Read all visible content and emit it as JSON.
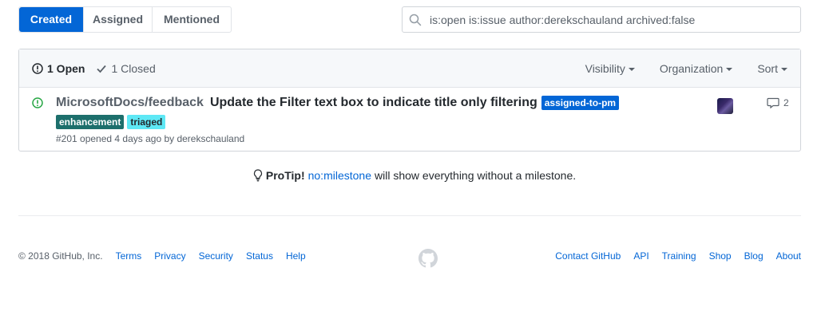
{
  "tabs": [
    {
      "label": "Created",
      "active": true
    },
    {
      "label": "Assigned",
      "active": false
    },
    {
      "label": "Mentioned",
      "active": false
    }
  ],
  "search": {
    "value": "is:open is:issue author:derekschauland archived:false",
    "icon": "search-icon"
  },
  "states": {
    "open_label": "1 Open",
    "closed_label": "1 Closed"
  },
  "filters": {
    "visibility": "Visibility",
    "organization": "Organization",
    "sort": "Sort"
  },
  "issue": {
    "repo": "MicrosoftDocs/feedback",
    "title": "Update the Filter text box to indicate title only filtering",
    "labels": [
      {
        "name": "assigned-to-pm",
        "bg": "#0366d6",
        "fg": "#ffffff"
      },
      {
        "name": "enhancement",
        "bg": "#1d6f6c",
        "fg": "#ffffff"
      },
      {
        "name": "triaged",
        "bg": "#5ee8f5",
        "fg": "#24292e"
      }
    ],
    "meta": "#201 opened 4 days ago by derekschauland",
    "comment_count": "2"
  },
  "protip": {
    "strong": "ProTip!",
    "link": "no:milestone",
    "text": "will show everything without a milestone."
  },
  "footer": {
    "copyright": "© 2018 GitHub, Inc.",
    "left_links": [
      "Terms",
      "Privacy",
      "Security",
      "Status",
      "Help"
    ],
    "right_links": [
      "Contact GitHub",
      "API",
      "Training",
      "Shop",
      "Blog",
      "About"
    ]
  },
  "colors": {
    "accent": "#0366d6",
    "open_green": "#28a745"
  }
}
